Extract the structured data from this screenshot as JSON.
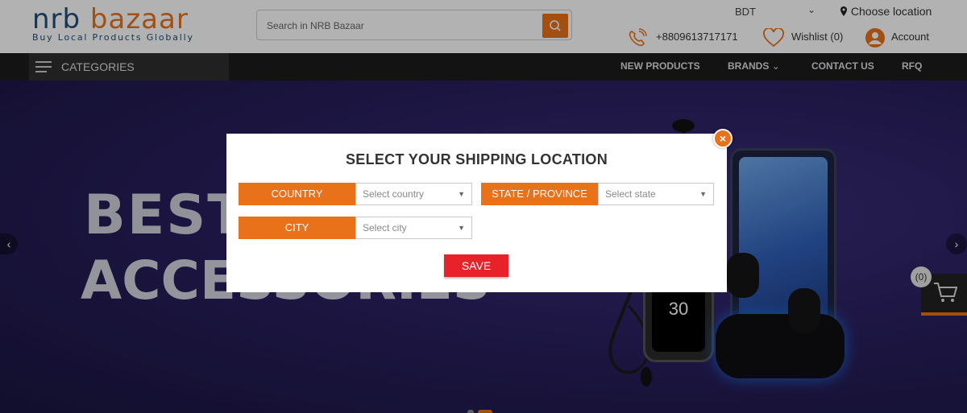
{
  "header": {
    "logo_left": "nrb",
    "logo_right": "bazaar",
    "logo_tagline": "Buy Local Products Globally",
    "search_placeholder": "Search in NRB Bazaar",
    "currency": "BDT",
    "choose_location": "Choose location",
    "phone": "+8809613717171",
    "wishlist": "Wishlist (0)",
    "account": "Account"
  },
  "nav": {
    "categories": "CATEGORIES",
    "items": [
      "NEW PRODUCTS",
      "BRANDS",
      "CONTACT US",
      "RFQ"
    ]
  },
  "hero": {
    "line1": "BEST",
    "line2": "ACCESSORIES",
    "watch_time": "30"
  },
  "cart": {
    "count": "(0)"
  },
  "modal": {
    "title": "SELECT YOUR SHIPPING LOCATION",
    "country_label": "COUNTRY",
    "country_placeholder": "Select country",
    "state_label": "STATE / PROVINCE",
    "state_placeholder": "Select state",
    "city_label": "CITY",
    "city_placeholder": "Select city",
    "save": "SAVE",
    "close": "×"
  },
  "colors": {
    "accent": "#e8711a",
    "save": "#e8222a",
    "brand_blue": "#1f4e79",
    "nav_bg": "#1c1c1c"
  }
}
